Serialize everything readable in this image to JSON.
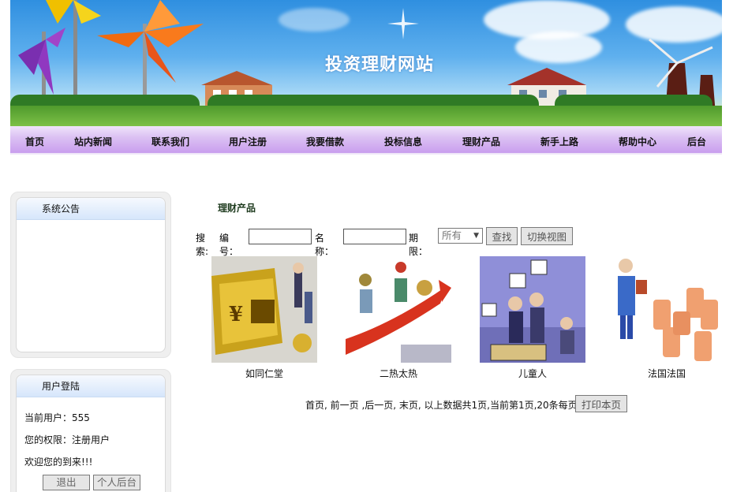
{
  "banner": {
    "title": "投资理财网站"
  },
  "nav": [
    {
      "label": "首页"
    },
    {
      "label": "站内新闻"
    },
    {
      "label": "联系我们"
    },
    {
      "label": "用户注册"
    },
    {
      "label": "我要借款"
    },
    {
      "label": "投标信息"
    },
    {
      "label": "理财产品"
    },
    {
      "label": "新手上路"
    },
    {
      "label": "帮助中心"
    },
    {
      "label": "后台"
    }
  ],
  "notice": {
    "title": "系统公告"
  },
  "login": {
    "title": "用户登陆",
    "current_user": "当前用户：555",
    "permission": "您的权限：注册用户",
    "welcome": "欢迎您的到来!!!",
    "logout_label": "退出",
    "personal_label": "个人后台"
  },
  "main": {
    "breadcrumb": "理财产品",
    "search": {
      "prefix": "搜索:",
      "code_label": "编号：",
      "code_value": "",
      "name_label": "名称：",
      "name_value": "",
      "term_label": "期限：",
      "term_selected": "所有",
      "find_label": "查找",
      "switch_label": "切换视图"
    },
    "products": [
      {
        "name": "如同仁堂",
        "image_icon": "bank-gold-sign-image"
      },
      {
        "name": "二热太热",
        "image_icon": "rising-arrow-investors-image"
      },
      {
        "name": "儿童人",
        "image_icon": "bank-wealth-product-image"
      },
      {
        "name": "法国法国",
        "image_icon": "man-gold-coin-stacks-image"
      }
    ],
    "pager": {
      "text": "首页, 前一页 ,后一页, 末页, 以上数据共1页,当前第1页,20条每页",
      "print_label": "打印本页"
    }
  },
  "colors": {
    "nav_bg": "#c99eee",
    "panel_head": "#d6e6fb",
    "sky": "#5fb0ee"
  }
}
